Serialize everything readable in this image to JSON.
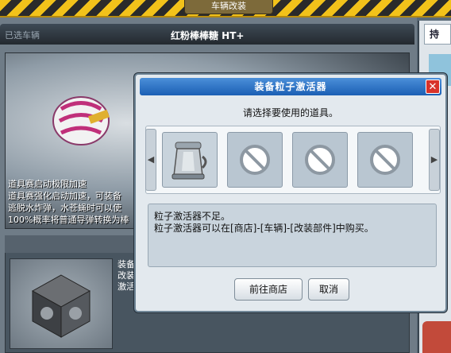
{
  "top": {
    "title": "车辆改装"
  },
  "vehicle": {
    "section_label": "已选车辆",
    "car_name": "红粉棒棒糖  HT+",
    "description": [
      "道具赛启动极限加速",
      "道具赛强化启动加速，可装备",
      "逃脱水炸弹，水苍蝇时可以使",
      "100%概率将普通导弹转换为棒"
    ],
    "parts_text": [
      "装备",
      "改装",
      "激活"
    ]
  },
  "right_panel": {
    "tab_label": "持"
  },
  "dialog": {
    "title": "装备粒子激活器",
    "close_label": "✕",
    "prompt": "请选择要使用的道具。",
    "slots": [
      {
        "name": "particle-activator-item",
        "available": true
      },
      {
        "name": "empty-slot",
        "available": false
      },
      {
        "name": "empty-slot",
        "available": false
      },
      {
        "name": "empty-slot",
        "available": false
      }
    ],
    "nav": {
      "left_glyph": "◀",
      "right_glyph": "▶"
    },
    "message_line1": "粒子激活器不足。",
    "message_line2": "粒子激活器可以在[商店]-[车辆]-[改装部件]中购买。",
    "buttons": {
      "shop": "前往商店",
      "cancel": "取消"
    }
  },
  "icons": {
    "blocked": "no-entry-icon",
    "close": "close-icon"
  },
  "colors": {
    "title_bar": "#2f77c8",
    "close": "#d8322a",
    "hazard": "#f2c21a"
  }
}
